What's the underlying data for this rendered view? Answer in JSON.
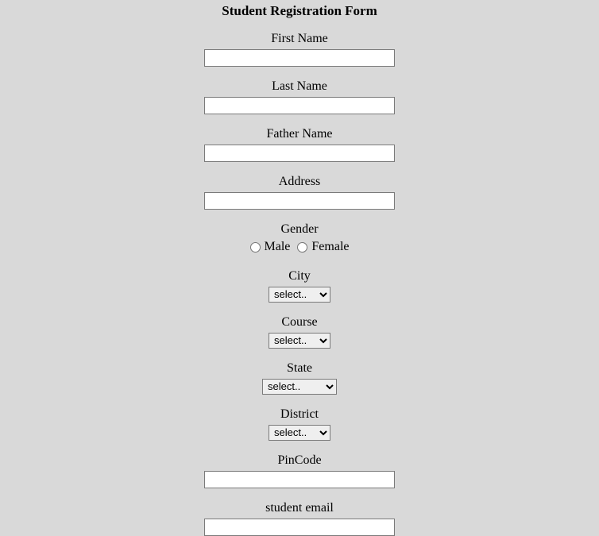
{
  "form": {
    "title": "Student Registration Form",
    "firstName": {
      "label": "First Name",
      "value": ""
    },
    "lastName": {
      "label": "Last Name",
      "value": ""
    },
    "fatherName": {
      "label": "Father Name",
      "value": ""
    },
    "address": {
      "label": "Address",
      "value": ""
    },
    "gender": {
      "label": "Gender",
      "option1": "Male",
      "option2": "Female"
    },
    "city": {
      "label": "City",
      "selected": "select.."
    },
    "course": {
      "label": "Course",
      "selected": "select.."
    },
    "state": {
      "label": "State",
      "selected": "select.."
    },
    "district": {
      "label": "District",
      "selected": "select.."
    },
    "pinCode": {
      "label": "PinCode",
      "value": ""
    },
    "studentEmail": {
      "label": "student email",
      "value": ""
    }
  }
}
